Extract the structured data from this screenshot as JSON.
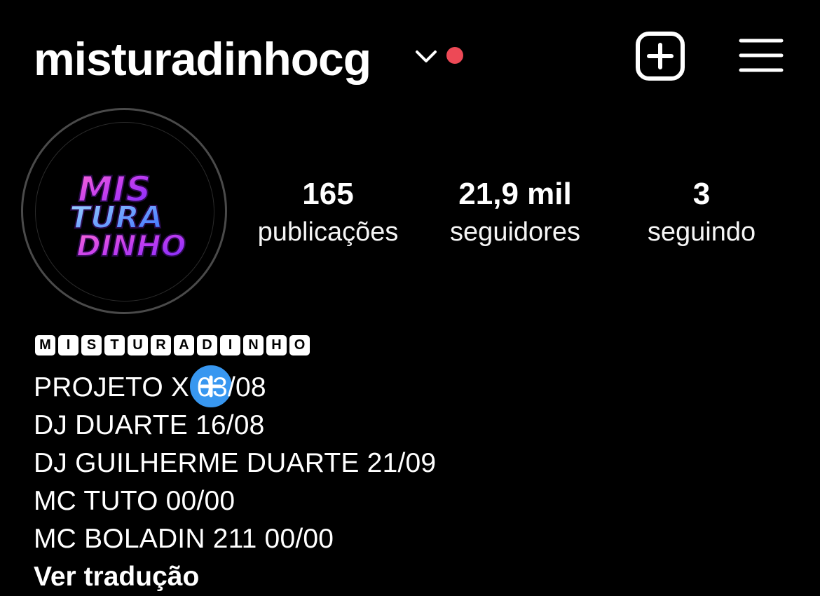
{
  "header": {
    "username": "misturadinhocg",
    "notification_color": "#ed4956",
    "new_post_icon": "plus-square-icon",
    "menu_icon": "hamburger-menu-icon"
  },
  "profile": {
    "avatar_logo_lines": [
      "MIS",
      "TURA",
      "DINHO"
    ],
    "add_story_color": "#3897f0",
    "stats": [
      {
        "value": "165",
        "label": "publicações"
      },
      {
        "value": "21,9 mil",
        "label": "seguidores"
      },
      {
        "value": "3",
        "label": "seguindo"
      }
    ]
  },
  "bio": {
    "name_letters": [
      "M",
      "I",
      "S",
      "T",
      "U",
      "R",
      "A",
      "D",
      "I",
      "N",
      "H",
      "O"
    ],
    "lines": [
      "PROJETO X 03/08",
      "DJ DUARTE 16/08",
      "DJ GUILHERME DUARTE 21/09",
      "MC TUTO 00/00",
      "MC BOLADIN 211 00/00"
    ],
    "translate_label": "Ver tradução"
  }
}
